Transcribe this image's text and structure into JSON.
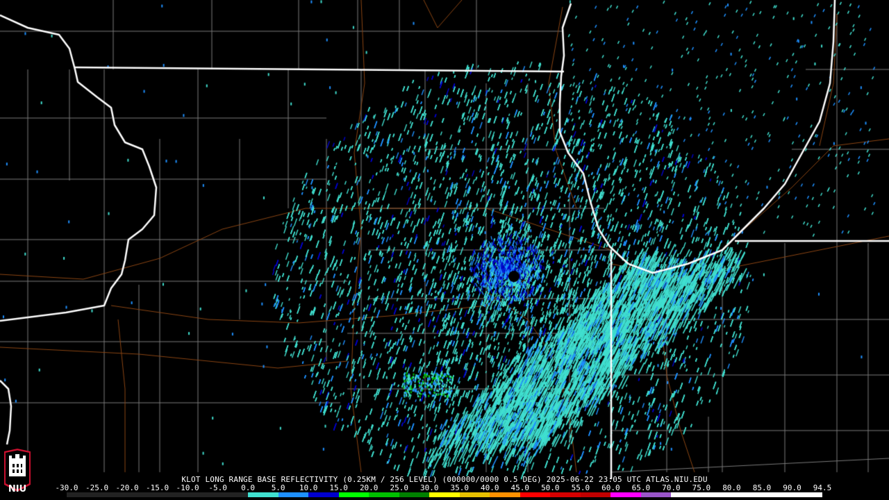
{
  "caption": {
    "site": "KLOT",
    "product": "LONG RANGE BASE REFLECTIVITY",
    "resolution": "(0.25KM / 256 LEVEL)",
    "mode": "(000000/0000 0.5 DEG)",
    "timestamp": "2025-06-22 23:05 UTC",
    "credit": "ATLAS.NIU.EDU"
  },
  "colorbar": {
    "labels": [
      "-30.0",
      "-25.0",
      "-20.0",
      "-15.0",
      "-10.0",
      "-5.0",
      "0.0",
      "5.0",
      "10.0",
      "15.0",
      "20.0",
      "25.0",
      "30.0",
      "35.0",
      "40.0",
      "45.0",
      "50.0",
      "55.0",
      "60.0",
      "65.0",
      "70.0",
      "75.0",
      "80.0",
      "85.0",
      "90.0",
      "94.5"
    ],
    "colors": [
      "#000000",
      "#000000",
      "#000000",
      "#000000",
      "#000000",
      "#000000",
      "#40e0d0",
      "#1e90ff",
      "#0000cd",
      "#00ff00",
      "#00c000",
      "#008000",
      "#ffff00",
      "#e7c000",
      "#ff9000",
      "#ff0000",
      "#d60000",
      "#c00000",
      "#ff00ff",
      "#9955c9",
      "#ffffff",
      "#ffffff",
      "#ffffff",
      "#ffffff",
      "#ffffff"
    ]
  },
  "logo": {
    "text": "NIU",
    "color": "#c8102e"
  },
  "map": {
    "background": "#000000",
    "state_border_color": "#ffffff",
    "county_line_color": "#7a7a7a",
    "road_color": "#8b4513",
    "echo_colors": [
      "#40e0d0",
      "#1e90ff",
      "#0000cd",
      "#00c000"
    ]
  }
}
